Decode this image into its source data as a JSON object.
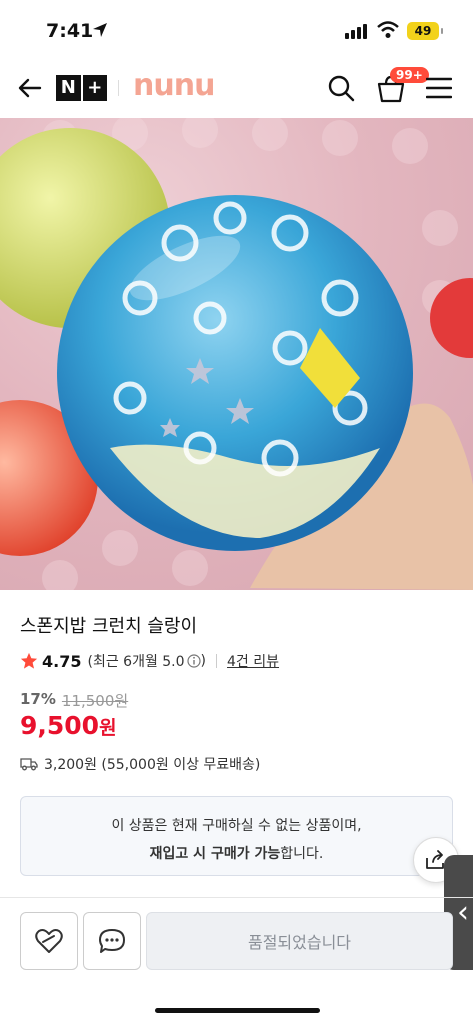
{
  "status_bar": {
    "time": "7:41",
    "battery": "49"
  },
  "header": {
    "brand_n": "N",
    "brand_plus": "+",
    "logo": "nunu",
    "cart_badge": "99+"
  },
  "product": {
    "title": "스폰지밥 크런치 슬랑이",
    "rating": "4.75",
    "recent_rating": "(최근 6개월 5.0",
    "recent_close": ")",
    "reviews": "4건 리뷰",
    "discount": "17%",
    "original_price": "11,500원",
    "price": "9,500",
    "price_unit": "원",
    "shipping": "3,200원 (55,000원 이상 무료배송)"
  },
  "notice": {
    "line1": "이 상품은 현재 구매하실 수 없는 상품이며,",
    "line2_bold": "재입고 시 구매가 가능",
    "line2_rest": "합니다."
  },
  "bottom_bar": {
    "soldout_label": "품절되었습니다"
  },
  "side_tab": {
    "label": "‹"
  },
  "colors": {
    "price": "#e8112d",
    "logo": "#f4a593",
    "star": "#ff4b3a",
    "badge": "#ff4b3a"
  }
}
